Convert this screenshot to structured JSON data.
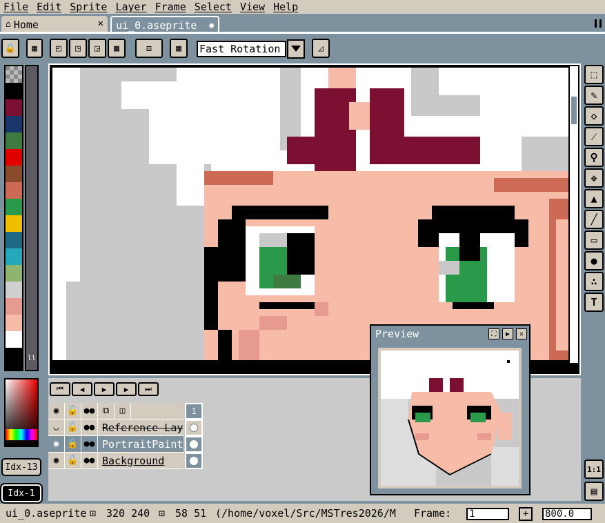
{
  "menu": [
    "File",
    "Edit",
    "Sprite",
    "Layer",
    "Frame",
    "Select",
    "View",
    "Help"
  ],
  "tabs": {
    "home_label": "Home",
    "home_close": "✕",
    "file_label": "ui_0.aseprite",
    "file_dot": "●"
  },
  "toolbar": {
    "rotation_algo": "Fast Rotation"
  },
  "palette_colors": [
    "#000000",
    "#7b1033",
    "#19366b",
    "#3f7a41",
    "#e00000",
    "#8a4a2b",
    "#cc6a55",
    "#2a9a4a",
    "#f0c000",
    "#1e6a86",
    "#25a9ba",
    "#8fb46f",
    "#cfcfcf",
    "#e79b90",
    "#f6bca8",
    "#ffffff"
  ],
  "colors": {
    "fg_index": "Idx-13",
    "bg_index": "Idx-1"
  },
  "layers": [
    {
      "name": "Reference Lay",
      "frame": ""
    },
    {
      "name": "PortraitPaint",
      "frame": ""
    },
    {
      "name": "Background",
      "frame": ""
    }
  ],
  "timeline": {
    "frame_header": "1"
  },
  "preview": {
    "title": "Preview"
  },
  "status": {
    "filename": "ui_0.aseprite",
    "size": "320 240",
    "pos": "58 51",
    "path": "(/home/voxel/Src/MSTres2026/M",
    "frame_label": "Frame:",
    "frame_value": "1",
    "plus": "+",
    "zoom": "800.0"
  }
}
